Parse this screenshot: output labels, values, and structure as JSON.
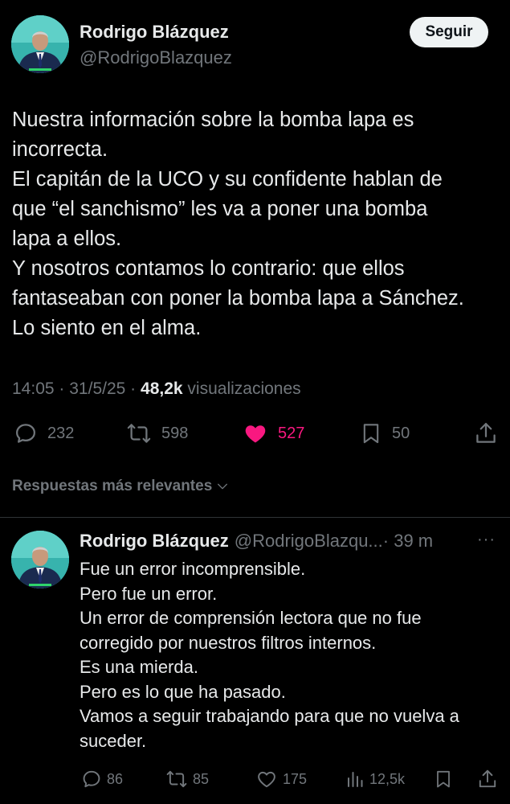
{
  "tweet": {
    "author_name": "Rodrigo Blázquez",
    "author_handle": "@RodrigoBlazquez",
    "follow_label": "Seguir",
    "body_lines": [
      "Nuestra información sobre la bomba lapa es",
      "incorrecta.",
      "El capitán de la UCO y su confidente hablan de",
      "que “el sanchismo” les va a poner una bomba",
      "lapa a ellos.",
      "Y nosotros contamos lo contrario: que ellos",
      "fantaseaban con poner la bomba lapa a Sánchez.",
      "Lo siento en el alma."
    ],
    "time": "14:05",
    "date": "31/5/25",
    "views_count": "48,2k",
    "views_label": "visualizaciones",
    "replies": "232",
    "retweets": "598",
    "likes": "527",
    "bookmarks": "50",
    "liked": true,
    "like_color": "#f91880"
  },
  "sort_label": "Respuestas más relevantes",
  "reply": {
    "author_name": "Rodrigo Blázquez",
    "author_handle": "@RodrigoBlazqu...",
    "time": "· 39 m",
    "more": "···",
    "body_lines": [
      "Fue un error incomprensible.",
      "Pero fue un error.",
      "Un error de comprensión lectora que no fue",
      "corregido por nuestros filtros internos.",
      "Es una mierda.",
      "Pero es lo que ha pasado.",
      "Vamos a seguir trabajando para que no vuelva a",
      "suceder."
    ],
    "replies": "86",
    "retweets": "85",
    "likes": "175",
    "views": "12,5k"
  },
  "icons": {
    "reply": "reply-icon",
    "retweet": "retweet-icon",
    "like": "heart-icon",
    "bookmark": "bookmark-icon",
    "share": "share-icon",
    "views": "views-icon",
    "sort": "chevron-down-icon"
  },
  "colors": {
    "background": "#000000",
    "text": "#e7e9ea",
    "muted": "#71767b",
    "like": "#f91880",
    "follow_button_bg": "#eff3f4",
    "avatar_bg": "#3fb6b0"
  }
}
